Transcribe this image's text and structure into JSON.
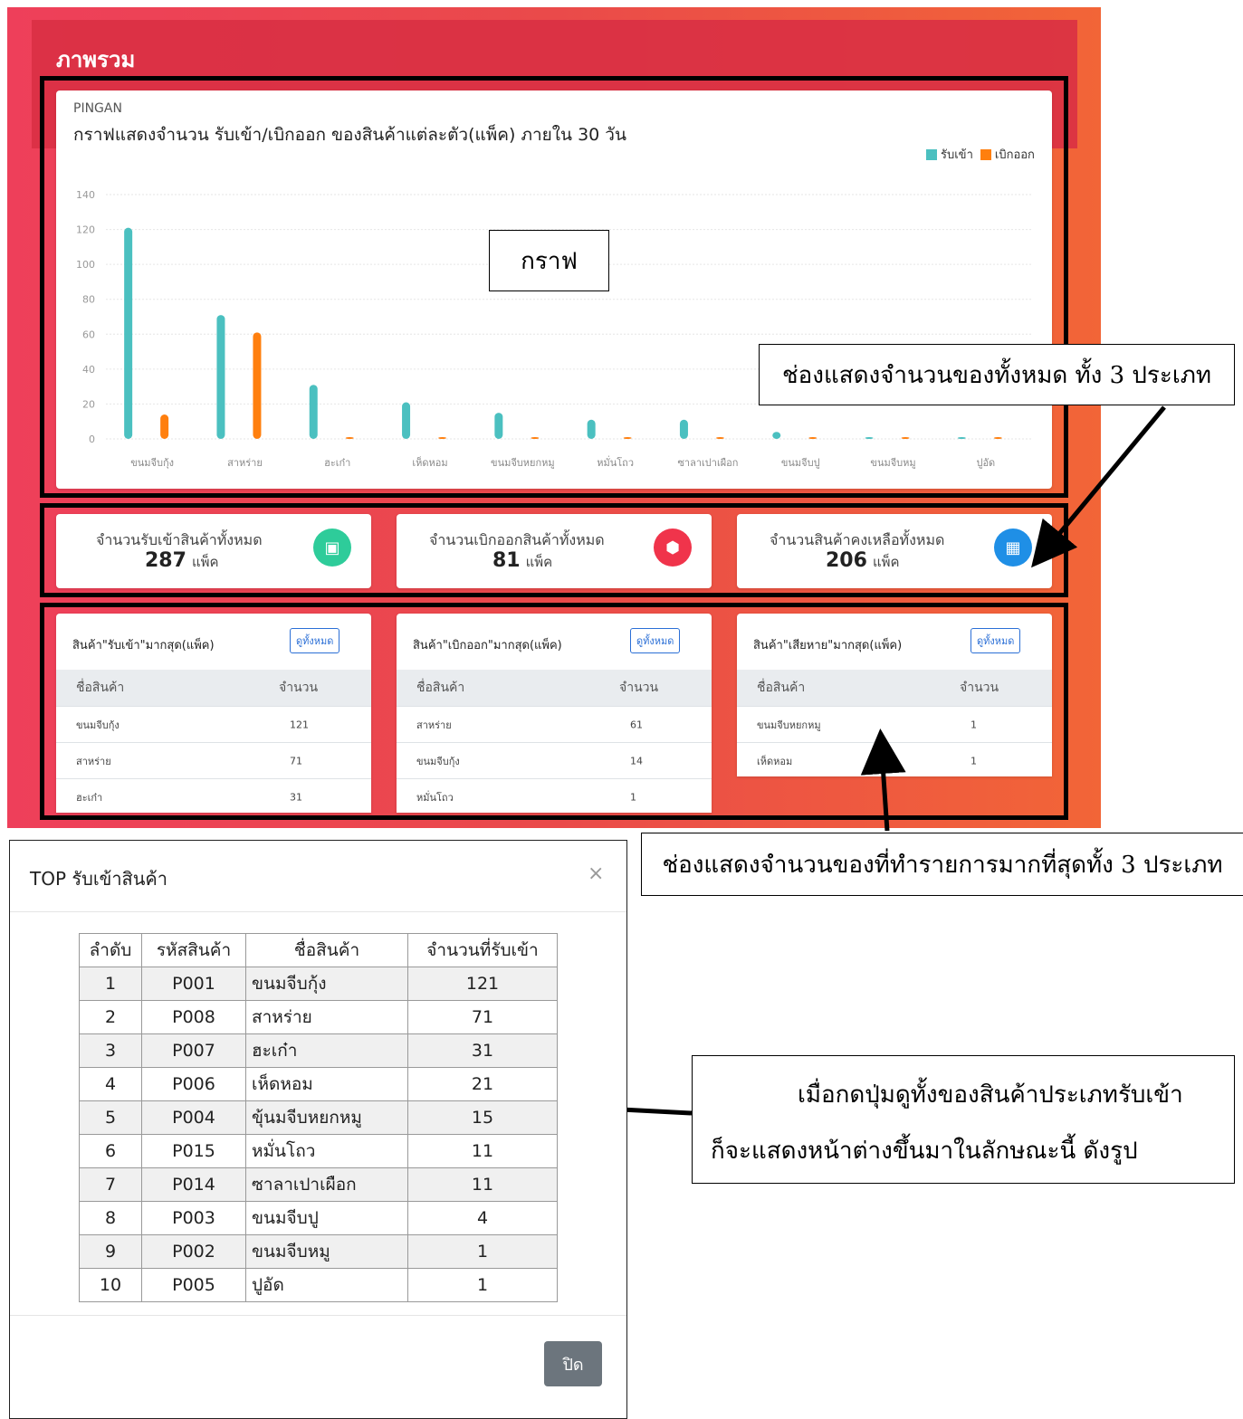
{
  "page_title": "ภาพรวม",
  "chart_card": {
    "brand": "PINGAN",
    "title": "กราฟแสดงจำนวน รับเข้า/เบิกออก ของสินค้าแต่ละตัว(แพ็ค) ภายใน 30 วัน"
  },
  "chart_data": {
    "type": "bar",
    "categories": [
      "ขนมจีบกุ้ง",
      "สาหร่าย",
      "ฮะเก๋า",
      "เห็ดหอม",
      "ขนมจีบหยกหมู",
      "หมั่นโถว",
      "ซาลาเปาเผือก",
      "ขนมจีบปู",
      "ขนมจีบหมู",
      "ปูอัด"
    ],
    "series": [
      {
        "name": "รับเข้า",
        "color": "#4bc0c0",
        "values": [
          121,
          71,
          31,
          21,
          15,
          11,
          11,
          4,
          1,
          1
        ]
      },
      {
        "name": "เบิกออก",
        "color": "#ff7f0e",
        "values": [
          14,
          61,
          1,
          0,
          0,
          1,
          1,
          1,
          1,
          1
        ]
      }
    ],
    "ylim": [
      0,
      140
    ],
    "yticks": [
      "0",
      "20",
      "40",
      "60",
      "80",
      "100",
      "120",
      "140"
    ],
    "legend": "top-right",
    "grid": true
  },
  "annotations": {
    "graph_label": "กราฟ",
    "stats_callout": "ช่องแสดงจำนวนของทั้งหมด ทั้ง 3 ประเภท",
    "top_callout": "ช่องแสดงจำนวนของที่ทำรายการมากที่สุดทั้ง 3 ประเภท",
    "modal_callout_line1": "เมื่อกดปุ่มดูทั้งของสินค้าประเภทรับเข้า",
    "modal_callout_line2": "ก็จะแสดงหน้าต่างขึ้นมาในลักษณะนี้ ดังรูป"
  },
  "stats": [
    {
      "label": "จำนวนรับเข้าสินค้าทั้งหมด",
      "value": "287",
      "unit": "แพ็ค",
      "icon": "box-open-icon",
      "color": "#2ecc9a"
    },
    {
      "label": "จำนวนเบิกออกสินค้าทั้งหมด",
      "value": "81",
      "unit": "แพ็ค",
      "icon": "cube-icon",
      "color": "#f0344b"
    },
    {
      "label": "จำนวนสินค้าคงเหลือทั้งหมด",
      "value": "206",
      "unit": "แพ็ค",
      "icon": "boxes-icon",
      "color": "#1f8fe6"
    }
  ],
  "top_cards": [
    {
      "title": "สินค้า\"รับเข้า\"มากสุด(แพ็ค)",
      "button": "ดูทั้งหมด",
      "col_name": "ชื่อสินค้า",
      "col_qty": "จำนวน",
      "rows": [
        {
          "name": "ขนมจีบกุ้ง",
          "qty": "121"
        },
        {
          "name": "สาหร่าย",
          "qty": "71"
        },
        {
          "name": "ฮะเก๋า",
          "qty": "31"
        }
      ]
    },
    {
      "title": "สินค้า\"เบิกออก\"มากสุด(แพ็ค)",
      "button": "ดูทั้งหมด",
      "col_name": "ชื่อสินค้า",
      "col_qty": "จำนวน",
      "rows": [
        {
          "name": "สาหร่าย",
          "qty": "61"
        },
        {
          "name": "ขนมจีบกุ้ง",
          "qty": "14"
        },
        {
          "name": "หมั่นโถว",
          "qty": "1"
        }
      ]
    },
    {
      "title": "สินค้า\"เสียหาย\"มากสุด(แพ็ค)",
      "button": "ดูทั้งหมด",
      "col_name": "ชื่อสินค้า",
      "col_qty": "จำนวน",
      "rows": [
        {
          "name": "ขนมจีบหยกหมู",
          "qty": "1"
        },
        {
          "name": "เห็ดหอม",
          "qty": "1"
        }
      ]
    }
  ],
  "modal": {
    "title": "TOP รับเข้าสินค้า",
    "close_icon": "×",
    "headers": [
      "ลำดับ",
      "รหัสสินค้า",
      "ชื่อสินค้า",
      "จำนวนที่รับเข้า"
    ],
    "rows": [
      [
        "1",
        "P001",
        "ขนมจีบกุ้ง",
        "121"
      ],
      [
        "2",
        "P008",
        "สาหร่าย",
        "71"
      ],
      [
        "3",
        "P007",
        "ฮะเก๋า",
        "31"
      ],
      [
        "4",
        "P006",
        "เห็ดหอม",
        "21"
      ],
      [
        "5",
        "P004",
        "ขุ้นมจีบหยกหมู",
        "15"
      ],
      [
        "6",
        "P015",
        "หมั่นโถว",
        "11"
      ],
      [
        "7",
        "P014",
        "ซาลาเปาเผือก",
        "11"
      ],
      [
        "8",
        "P003",
        "ขนมจีบปู",
        "4"
      ],
      [
        "9",
        "P002",
        "ขนมจีบหมู",
        "1"
      ],
      [
        "10",
        "P005",
        "ปูอัด",
        "1"
      ]
    ],
    "close_button": "ปิด"
  }
}
